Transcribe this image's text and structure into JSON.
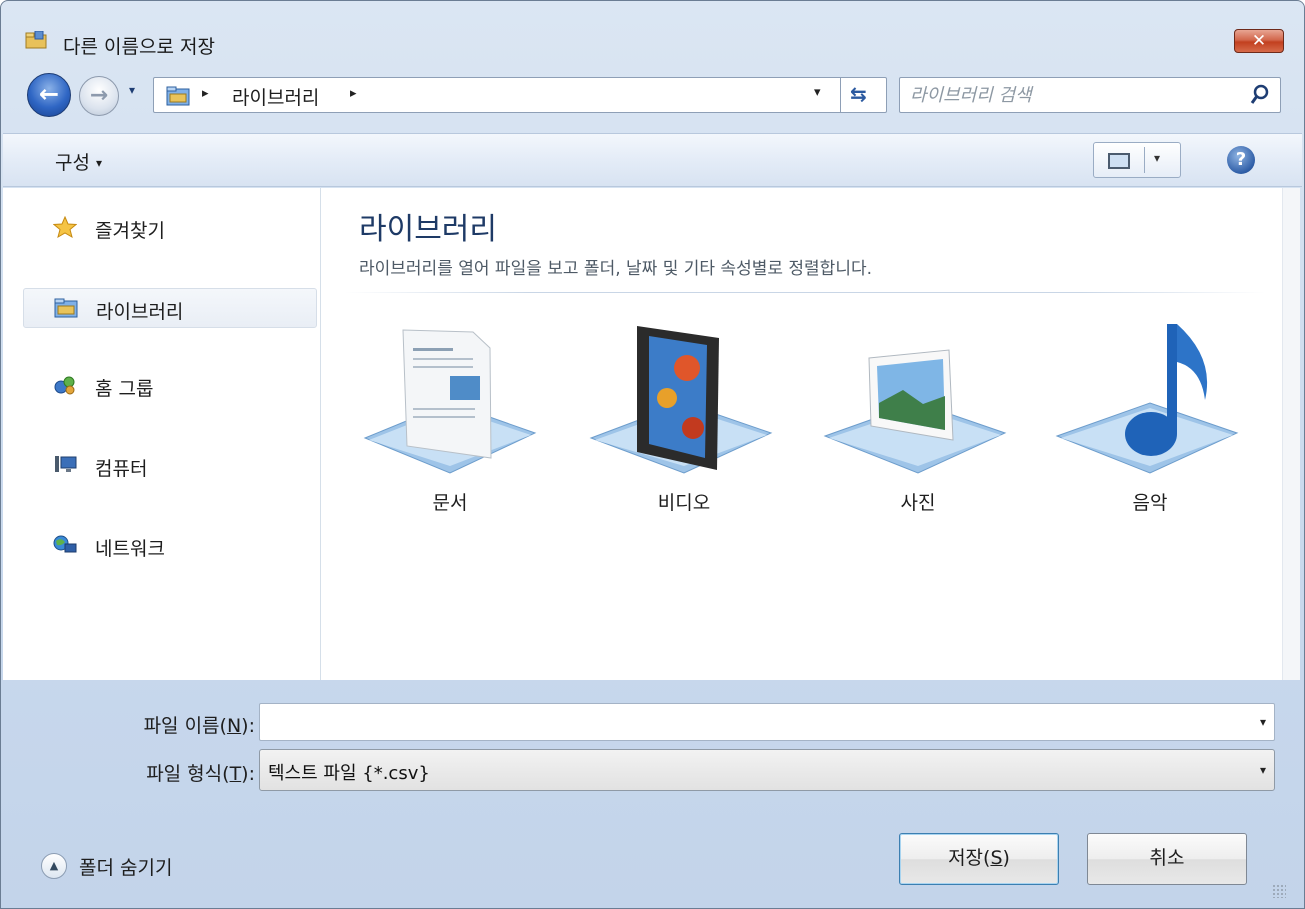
{
  "window": {
    "title": "다른 이름으로 저장",
    "close_label": "✕"
  },
  "nav": {
    "back_icon": "back-arrow-icon",
    "forward_icon": "forward-arrow-icon",
    "history_arrow": "▾",
    "address": {
      "separator": "▸",
      "crumb": "라이브러리",
      "dropdown_arrow": "▾",
      "refresh_glyph": "⇆"
    },
    "search": {
      "placeholder": "라이브러리 검색"
    }
  },
  "toolbar": {
    "organize_label": "구성",
    "organize_arrow": "▾",
    "view_arrow": "▾",
    "help_label": "?"
  },
  "sidebar": {
    "items": [
      {
        "label": "즐겨찾기",
        "icon": "star-icon"
      },
      {
        "label": "라이브러리",
        "icon": "library-icon",
        "selected": true
      },
      {
        "label": "홈 그룹",
        "icon": "homegroup-icon"
      },
      {
        "label": "컴퓨터",
        "icon": "computer-icon"
      },
      {
        "label": "네트워크",
        "icon": "network-icon"
      }
    ]
  },
  "main": {
    "title": "라이브러리",
    "description": "라이브러리를 열어 파일을 보고 폴더, 날짜 및 기타 속성별로 정렬합니다.",
    "libraries": [
      {
        "label": "문서",
        "icon": "documents-icon"
      },
      {
        "label": "비디오",
        "icon": "videos-icon"
      },
      {
        "label": "사진",
        "icon": "pictures-icon"
      },
      {
        "label": "음악",
        "icon": "music-icon"
      }
    ]
  },
  "form": {
    "filename_label": "파일 이름(",
    "filename_accel": "N",
    "filename_suffix": "):",
    "filename_value": "",
    "filetype_label": "파일 형식(",
    "filetype_accel": "T",
    "filetype_suffix": "):",
    "filetype_value": "텍스트 파일 {*.csv}",
    "dropdown_arrow": "▾"
  },
  "footer": {
    "hide_folders_label": "폴더 숨기기",
    "hide_icon_glyph": "▲",
    "save_label": "저장(",
    "save_accel": "S",
    "save_suffix": ")",
    "cancel_label": "취소"
  },
  "colors": {
    "frame": "#c9d9ed",
    "close_button": "#c2401f",
    "title_text": "#1e3a66",
    "accent": "#2f66c4"
  }
}
